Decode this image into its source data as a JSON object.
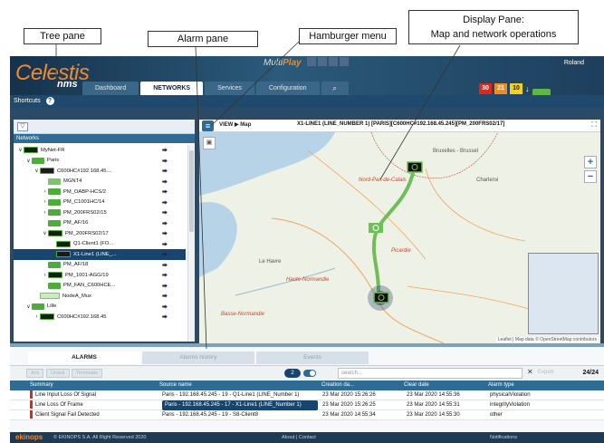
{
  "annotations": {
    "tree_pane": "Tree pane",
    "alarm_pane": "Alarm pane",
    "hamburger_menu": "Hamburger menu",
    "display_pane_line1": "Display Pane:",
    "display_pane_line2": "Map and network operations"
  },
  "header": {
    "logo": "Celestis",
    "logo_sub": "nms",
    "multiplay_prefix": "Multi",
    "multiplay_suffix": "Play",
    "user": "Roland",
    "tabs": [
      "Dashboard",
      "NETWORKS",
      "Services",
      "Configuration"
    ],
    "active_tab": "NETWORKS",
    "counters": {
      "critical": "30",
      "major": "21",
      "minor": "10"
    },
    "colors": {
      "critical": "#e3261d",
      "major": "#f28c1f",
      "minor": "#f7d018",
      "accent": "#2e6c95",
      "brand": "#f3892b"
    }
  },
  "shortcuts": {
    "label": "Shortcuts"
  },
  "tree": {
    "title": "Networks",
    "rows": [
      {
        "label": "MyNet-FR",
        "indent": 0,
        "chev": "∨",
        "icon": "dark"
      },
      {
        "label": "Paris",
        "indent": 1,
        "chev": "∨",
        "icon": "green"
      },
      {
        "label": "C600HC#192.168.45....",
        "indent": 2,
        "chev": "∨",
        "icon": "dark"
      },
      {
        "label": "MGNT4",
        "indent": 3,
        "chev": "",
        "icon": "m"
      },
      {
        "label": "PM_OABP-HCS/2",
        "indent": 3,
        "chev": "›",
        "icon": "green"
      },
      {
        "label": "PM_C1001HC/14",
        "indent": 3,
        "chev": "›",
        "icon": "green"
      },
      {
        "label": "PM_200FRS02/15",
        "indent": 3,
        "chev": "›",
        "icon": "green"
      },
      {
        "label": "PM_AF/16",
        "indent": 3,
        "chev": "",
        "icon": "green"
      },
      {
        "label": "PM_200FRS02/17",
        "indent": 3,
        "chev": "∨",
        "icon": "dark"
      },
      {
        "label": "Q1-Client1 (FO...",
        "indent": 4,
        "chev": "",
        "icon": "dark"
      },
      {
        "label": "X1-Line1 (LINE_...",
        "indent": 4,
        "chev": "",
        "icon": "dark",
        "selected": true
      },
      {
        "label": "PM_AF/18",
        "indent": 3,
        "chev": "",
        "icon": "green"
      },
      {
        "label": "PM_1001-AGG/19",
        "indent": 3,
        "chev": "›",
        "icon": "dark"
      },
      {
        "label": "PM_FAN_C600HCE...",
        "indent": 3,
        "chev": "",
        "icon": "green"
      },
      {
        "label": "NodeA_Mux",
        "indent": 2,
        "chev": "",
        "icon": "link"
      },
      {
        "label": "Lille",
        "indent": 1,
        "chev": "∨",
        "icon": "green"
      },
      {
        "label": "C600HC#192.168.45",
        "indent": 2,
        "chev": "›",
        "icon": "dark"
      }
    ]
  },
  "map": {
    "view_crumb": "VIEW ▶ Map",
    "title": "X1-LINE1 (LINE_NUMBER 1) [PARIS][C600HC#192.168.45.245][PM_200FRS02/17]",
    "labels": {
      "brussels": "Bruxelles - Brussel",
      "nord": "Nord-Pas-de-Calais",
      "picardie": "Picardie",
      "haute_normandie": "Haute-Normandie",
      "basse_normandie": "Basse-Normandie",
      "le_havre": "Le Havre",
      "charleroi": "Charleroi"
    },
    "attribution": "Leaflet | Map data © OpenStreetMap contributors"
  },
  "alarms": {
    "tabs": [
      "ALARMS",
      "Alarms history",
      "Events"
    ],
    "active_tab": "ALARMS",
    "toolbar": {
      "ack": "Ack",
      "unack": "Unack",
      "terminate": "Terminate",
      "count_badge": "2",
      "search_placeholder": "search...",
      "export": "Export",
      "count": "24/24"
    },
    "columns": [
      "Summary",
      "Source name",
      "Creation da...",
      "Clear date",
      "Alarm type"
    ],
    "rows": [
      {
        "summary": "Line Input Loss Of Signal",
        "source": "Paris - 192.168.45.245 - 19 - Q1-Line1 (LINE_Number 1)",
        "created": "23 Mar 2020 15:26:26",
        "cleared": "23 Mar 2020 14:55:36",
        "type": "physicalViolation"
      },
      {
        "summary": "Line Loss Of Frame",
        "source": "Paris - 192.168.45.245 - 17 - X1-Line1 (LINE_Number 1)",
        "created": "23 Mar 2020 15:26:25",
        "cleared": "23 Mar 2020 14:55:31",
        "type": "integrityViolation"
      },
      {
        "summary": "Client Signal Fail Detected",
        "source": "Paris - 192.168.45.245 - 19 - S8-Client8",
        "created": "23 Mar 2020 14:55:34",
        "cleared": "23 Mar 2020 14:55:30",
        "type": "other"
      }
    ]
  },
  "footer": {
    "brand": "ekinops",
    "copyright": "© EKINOPS S.A. All Right Reserved 2020",
    "about": "About | Contact",
    "notifications": "Notifications"
  }
}
